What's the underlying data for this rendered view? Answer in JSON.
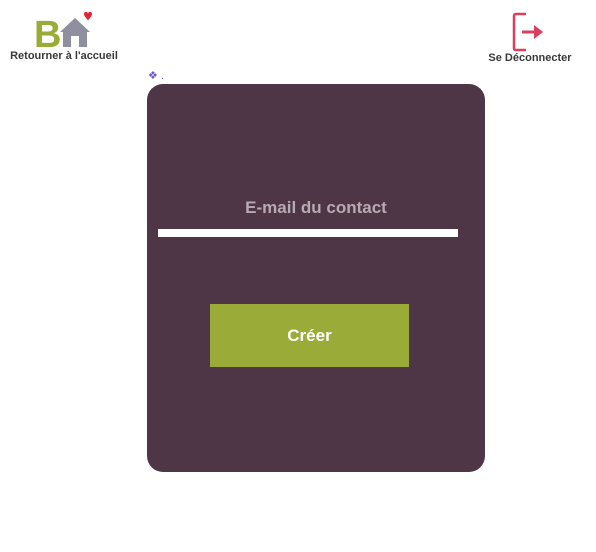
{
  "header": {
    "home": {
      "label": "Retourner à l'accueil",
      "logo_letter": "B",
      "icon": "home-logo-icon"
    },
    "logout": {
      "label": "Se Déconnecter",
      "icon": "logout-icon"
    }
  },
  "form": {
    "email_label": "E-mail du contact",
    "email_value": "",
    "submit_label": "Créer"
  },
  "colors": {
    "card_background": "#4e3647",
    "button_background": "#9aab37",
    "logo_green": "#9aab37",
    "logout_red": "#d9405e",
    "heart_red": "#e0243a"
  }
}
